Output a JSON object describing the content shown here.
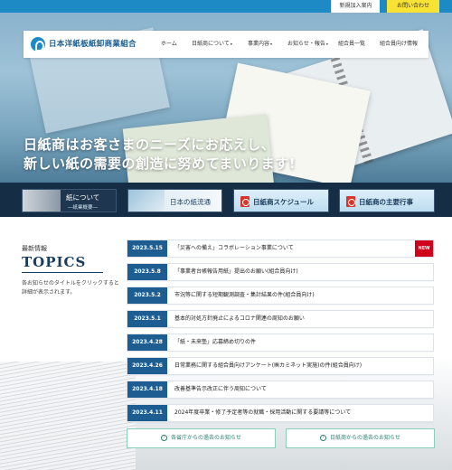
{
  "utility": {
    "member_label": "新規加入案内",
    "contact_label": "お問い合わせ"
  },
  "header": {
    "logo_text": "日本洋紙板紙卸商業組合",
    "nav": [
      {
        "label": "ホーム",
        "has_dropdown": false
      },
      {
        "label": "日紙商について",
        "has_dropdown": true
      },
      {
        "label": "事業内容",
        "has_dropdown": true
      },
      {
        "label": "お知らせ・報告",
        "has_dropdown": true
      },
      {
        "label": "組合員一覧",
        "has_dropdown": false
      },
      {
        "label": "組合員向け情報",
        "has_dropdown": false
      }
    ],
    "caret": "▾"
  },
  "hero": {
    "line1": "日紙商はお客さまのニーズにお応えし、",
    "line2": "新しい紙の需要の創造に努めてまいります!"
  },
  "banners": [
    {
      "title": "紙について",
      "subtitle": "―紙業概要―"
    },
    {
      "title": "日本の紙流通"
    },
    {
      "title": "日紙商スケジュール",
      "icon": "pdf-icon"
    },
    {
      "title": "日紙商の主要行事",
      "icon": "pdf-icon"
    }
  ],
  "topics": {
    "label": "最新情報",
    "title": "TOPICS",
    "description": "各お知らせのタイトルをクリックすると詳細が表示されます。",
    "items": [
      {
        "date": "2023.5.15",
        "title": "「災害への備え」コラボレーション事業について",
        "badge": "NEW"
      },
      {
        "date": "2023.5.8",
        "title": "「事業者台帳報告用紙」提出のお願い(組合員向け)"
      },
      {
        "date": "2023.5.2",
        "title": "市況等に関する短期観測調査・集計結果の件(組合員向け)"
      },
      {
        "date": "2023.5.1",
        "title": "基本的対処方針廃止によるコロナ関連の周知のお願い"
      },
      {
        "date": "2023.4.28",
        "title": "「紙・未来塾」応募締め切りの件"
      },
      {
        "date": "2023.4.26",
        "title": "日常業務に関する組合員向けアンケート(㈱カミネット実施)の件(組合員向け)"
      },
      {
        "date": "2023.4.18",
        "title": "改善基準告示改正に伴う周知について"
      },
      {
        "date": "2023.4.11",
        "title": "2024年度卒業・修了予定者等の就職・採用活動に関する要請等について"
      }
    ]
  },
  "past_buttons": {
    "left": "各省庁からの過去のお知らせ",
    "right": "日紙商からの過去のお知らせ",
    "chevron": "›"
  },
  "colors": {
    "brand_blue": "#1d8ac6",
    "navy": "#1d5d91",
    "accent_yellow": "#f8e233",
    "new_badge": "#d0021b",
    "green_outline": "#8ccfb8"
  }
}
